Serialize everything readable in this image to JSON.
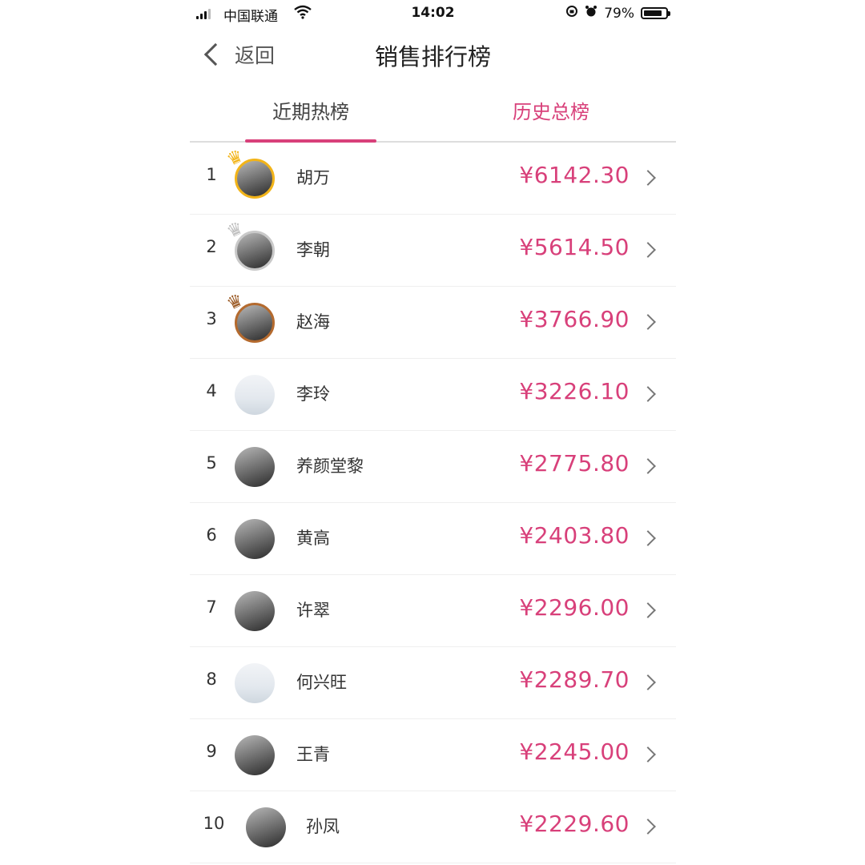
{
  "status_bar": {
    "carrier": "中国联通",
    "time": "14:02",
    "battery_percent": "79%"
  },
  "nav": {
    "back_label": "返回",
    "title": "销售排行榜"
  },
  "tabs": {
    "recent": "近期热榜",
    "history": "历史总榜",
    "active": "recent"
  },
  "colors": {
    "accent": "#d8407a",
    "gold": "#f2b419",
    "silver": "#c9c9c9",
    "bronze": "#b46a2e"
  },
  "ranking": [
    {
      "rank": "1",
      "name": "胡万",
      "amount": "¥6142.30"
    },
    {
      "rank": "2",
      "name": "李朝",
      "amount": "¥5614.50"
    },
    {
      "rank": "3",
      "name": "赵海",
      "amount": "¥3766.90"
    },
    {
      "rank": "4",
      "name": "李玲",
      "amount": "¥3226.10"
    },
    {
      "rank": "5",
      "name": "养颜堂黎",
      "amount": "¥2775.80"
    },
    {
      "rank": "6",
      "name": "黄高",
      "amount": "¥2403.80"
    },
    {
      "rank": "7",
      "name": "许翠",
      "amount": "¥2296.00"
    },
    {
      "rank": "8",
      "name": "何兴旺",
      "amount": "¥2289.70"
    },
    {
      "rank": "9",
      "name": "王青",
      "amount": "¥2245.00"
    },
    {
      "rank": "10",
      "name": "孙凤",
      "amount": "¥2229.60"
    }
  ]
}
